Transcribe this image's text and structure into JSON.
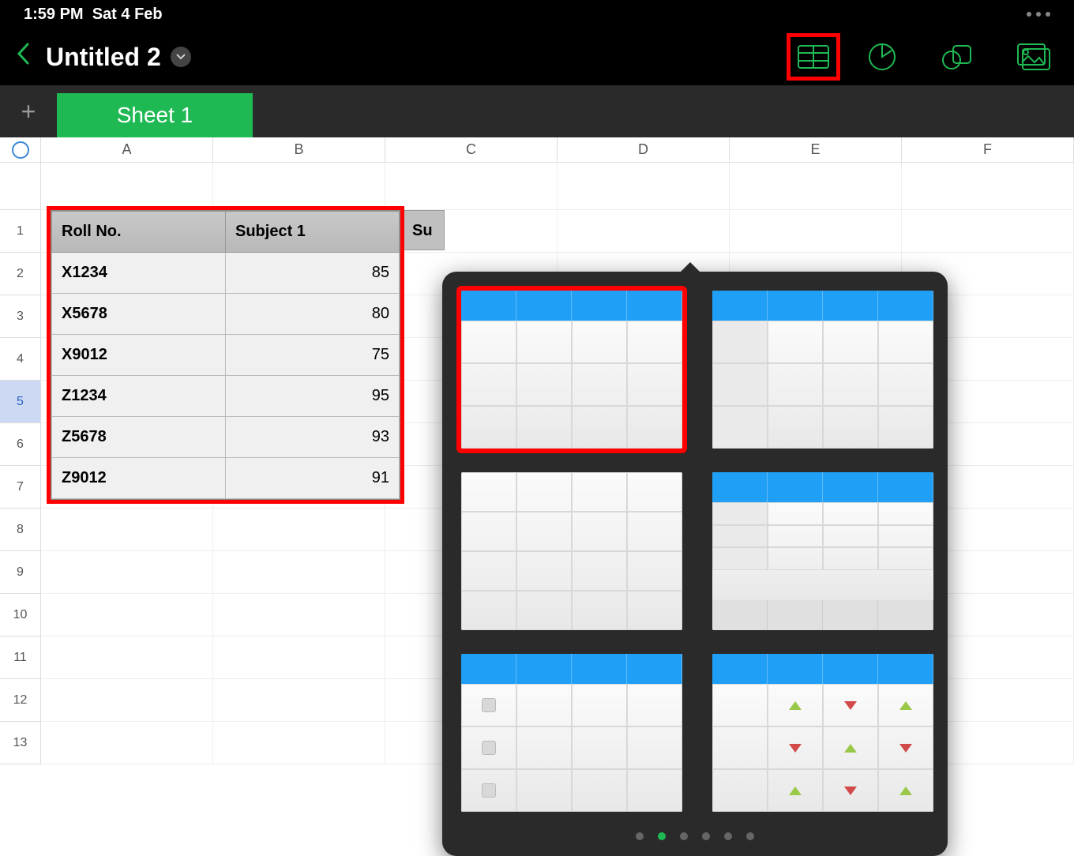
{
  "status": {
    "time": "1:59 PM",
    "date": "Sat 4 Feb"
  },
  "doc": {
    "title": "Untitled 2"
  },
  "tabs": {
    "active": "Sheet 1"
  },
  "columns": [
    "A",
    "B",
    "C",
    "D",
    "E",
    "F"
  ],
  "table": {
    "headers": [
      "Roll No.",
      "Subject 1"
    ],
    "partial_header": "Su",
    "rows": [
      {
        "roll": "X1234",
        "val": "85"
      },
      {
        "roll": "X5678",
        "val": "80"
      },
      {
        "roll": "X9012",
        "val": "75"
      },
      {
        "roll": "Z1234",
        "val": "95"
      },
      {
        "roll": "Z5678",
        "val": "93"
      },
      {
        "roll": "Z9012",
        "val": "91"
      }
    ]
  },
  "selected_row": 5,
  "popover": {
    "page_count": 6,
    "active_page": 1
  }
}
